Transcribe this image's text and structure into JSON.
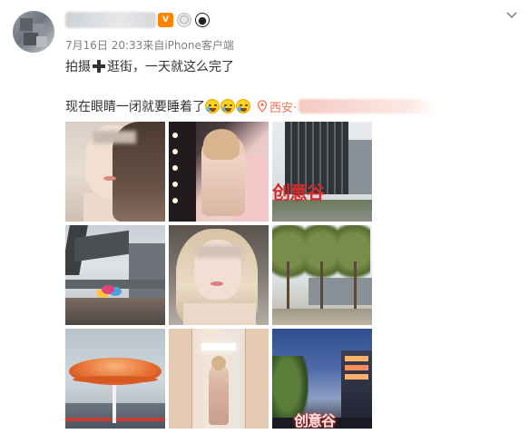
{
  "post": {
    "meta": {
      "date": "7月16日",
      "time": "20:33",
      "source": "来自iPhone客户端"
    },
    "text": {
      "line1_before": "拍摄",
      "line1_after": "逛街，一天就这么完了",
      "line2": "现在眼睛一闭就要睡着了"
    },
    "location": {
      "label": "西安·"
    },
    "badges": {
      "vip": "V"
    },
    "sign_text": "创意谷"
  },
  "icons": {
    "chevron": "chevron-down-icon",
    "location": "location-pin-icon",
    "emoji": "sleepy-crying-emoji-icon"
  },
  "colors": {
    "meta_text": "#808080",
    "location_text": "#eb7350",
    "vip_badge": "#ff8200"
  }
}
